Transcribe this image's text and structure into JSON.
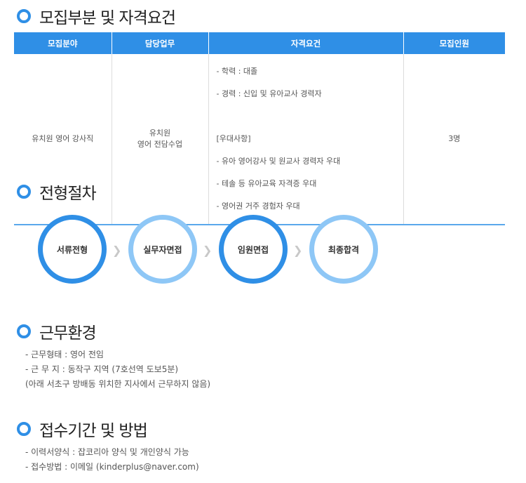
{
  "sections": {
    "recruit": "모집부분 및 자격요건",
    "process": "전형절차",
    "environment": "근무환경",
    "application": "접수기간 및 방법"
  },
  "table": {
    "headers": [
      "모집분야",
      "담당업무",
      "자격요건",
      "모집인원"
    ],
    "field": "유치원 영어 강사직",
    "duty_line1": "유치원",
    "duty_line2": "영어 전담수업",
    "qualifications": [
      "- 학력 : 대졸",
      "- 경력 : 신입 및 유아교사 경력자",
      "",
      "[우대사항]",
      "- 유아 영어강사 및 원교사 경력자 우대",
      "- 테솔 등 유아교육 자격증 우대",
      "- 영어권 거주 경험자 우대"
    ],
    "count": "3명"
  },
  "steps": [
    "서류전형",
    "실무자면접",
    "임원면접",
    "최종합격"
  ],
  "environment": [
    "- 근무형태 : 영어 전임",
    "- 근 무 지 : 동작구 지역 (7호선역 도보5분)",
    "(아래 서초구 방배동 위치한 지사에서 근무하지 않음)"
  ],
  "application": [
    "- 이력서양식 : 잡코리아 양식 및 개인양식 가능",
    "- 접수방법 : 이메일 (kinderplus@naver.com)"
  ],
  "colors": {
    "accent": "#2f8fe6",
    "accent_light": "#8ec7f6"
  }
}
